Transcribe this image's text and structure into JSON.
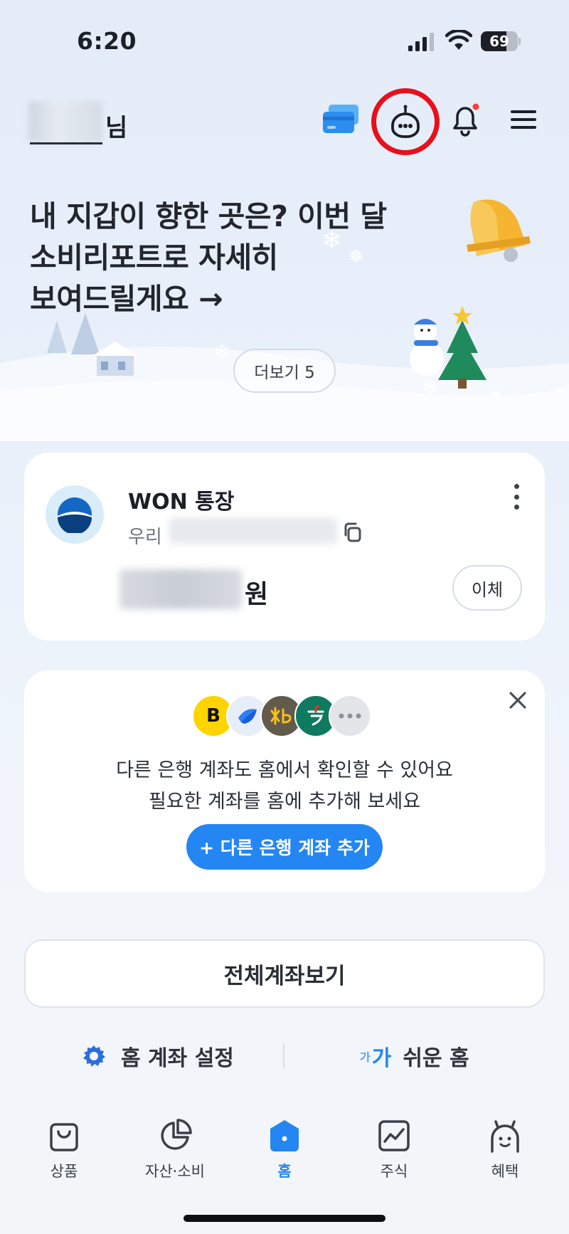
{
  "status_bar": {
    "time": "6:20",
    "battery_level": "69"
  },
  "header": {
    "user_suffix": "님"
  },
  "hero": {
    "lines": [
      "내 지갑이 향한 곳은? 이번 달",
      "소비리포트로 자세히",
      "보여드릴게요 →"
    ],
    "more_label": "더보기 5"
  },
  "account_card": {
    "name": "WON 통장",
    "bank": "우리",
    "balance_suffix": "원",
    "transfer_label": "이체"
  },
  "promo_card": {
    "line1": "다른 은행 계좌도 홈에서 확인할 수 있어요",
    "line2": "필요한 계좌를 홈에 추가해 보세요",
    "button_label": "+ 다른 은행 계좌 추가",
    "bank_icons": [
      "B",
      "toss",
      "kb",
      "hana",
      "more"
    ]
  },
  "all_accounts_label": "전체계좌보기",
  "home_settings_label": "홈 계좌 설정",
  "easy_home": {
    "small": "가",
    "big": "가",
    "label": "쉬운 홈"
  },
  "tabs": [
    {
      "label": "상품",
      "icon": "bag-icon"
    },
    {
      "label": "자산·소비",
      "icon": "pie-chart-icon"
    },
    {
      "label": "홈",
      "icon": "home-icon"
    },
    {
      "label": "주식",
      "icon": "stock-chart-icon"
    },
    {
      "label": "혜택",
      "icon": "benefit-character-icon"
    }
  ],
  "colors": {
    "accent": "#2386f2",
    "highlight_ring": "#e8101b",
    "notification_dot": "#ff3b3b"
  }
}
